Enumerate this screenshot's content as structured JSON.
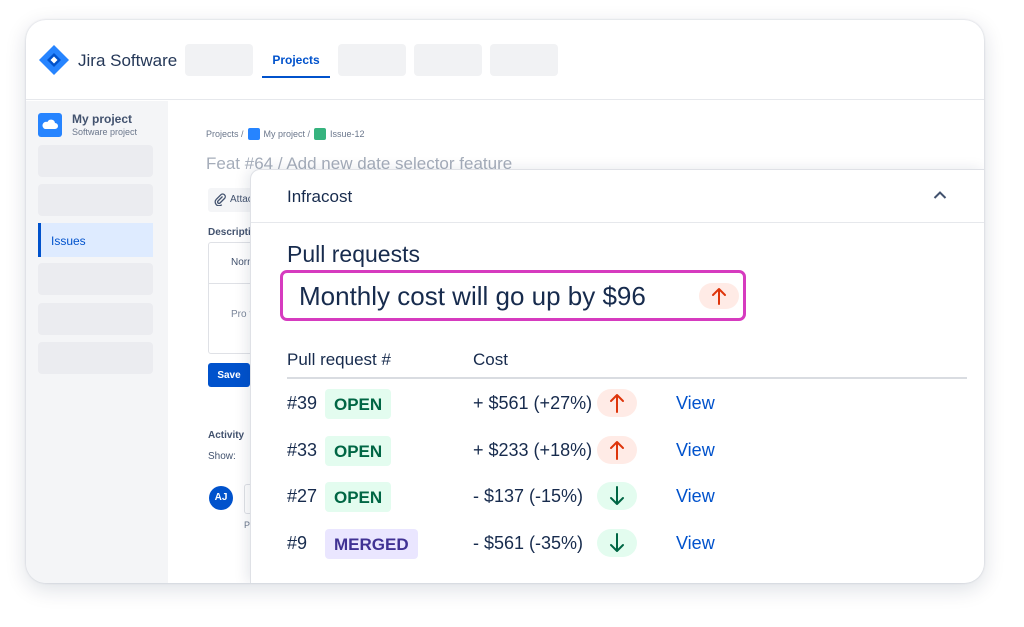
{
  "topnav": {
    "brand": "Jira Software",
    "active_tab": "Projects"
  },
  "sidebar": {
    "project_name": "My project",
    "project_type": "Software project",
    "active_item": "Issues"
  },
  "issue": {
    "breadcrumb": {
      "projects": "Projects /",
      "project": "My project /",
      "issue": "Issue-12"
    },
    "title": "Feat #64 / Add new date selector feature",
    "attach_label": "Attach",
    "description_label": "Description",
    "editor_style": "Normal text",
    "editor_placeholder": "Pro tip",
    "save_label": "Save",
    "activity_label": "Activity",
    "show_label": "Show:",
    "avatar_initials": "AJ",
    "pro_tip": "P"
  },
  "infracost": {
    "panel_title": "Infracost",
    "heading": "Pull requests",
    "summary": "Monthly cost will go up by $96",
    "summary_direction": "up",
    "columns": {
      "pr": "Pull request #",
      "cost": "Cost"
    },
    "rows": [
      {
        "number": "#39",
        "status": "OPEN",
        "cost": "+ $561 (+27%)",
        "direction": "up",
        "link": "View"
      },
      {
        "number": "#33",
        "status": "OPEN",
        "cost": "+ $233 (+18%)",
        "direction": "up",
        "link": "View"
      },
      {
        "number": "#27",
        "status": "OPEN",
        "cost": "- $137 (-15%)",
        "direction": "down",
        "link": "View"
      },
      {
        "number": "#9",
        "status": "MERGED",
        "cost": "- $561 (-35%)",
        "direction": "down",
        "link": "View"
      }
    ]
  },
  "colors": {
    "brand_blue": "#0052cc",
    "highlight_border": "#d63bbf",
    "cost_up": "#de350b",
    "cost_down": "#006644",
    "open_badge_bg": "#e3fcef",
    "merged_badge_bg": "#eae6ff"
  },
  "icons": {
    "logo": "jira-logo-icon",
    "collapse": "chevron-up-icon",
    "attach": "paperclip-icon",
    "up": "arrow-up-icon",
    "down": "arrow-down-icon"
  }
}
